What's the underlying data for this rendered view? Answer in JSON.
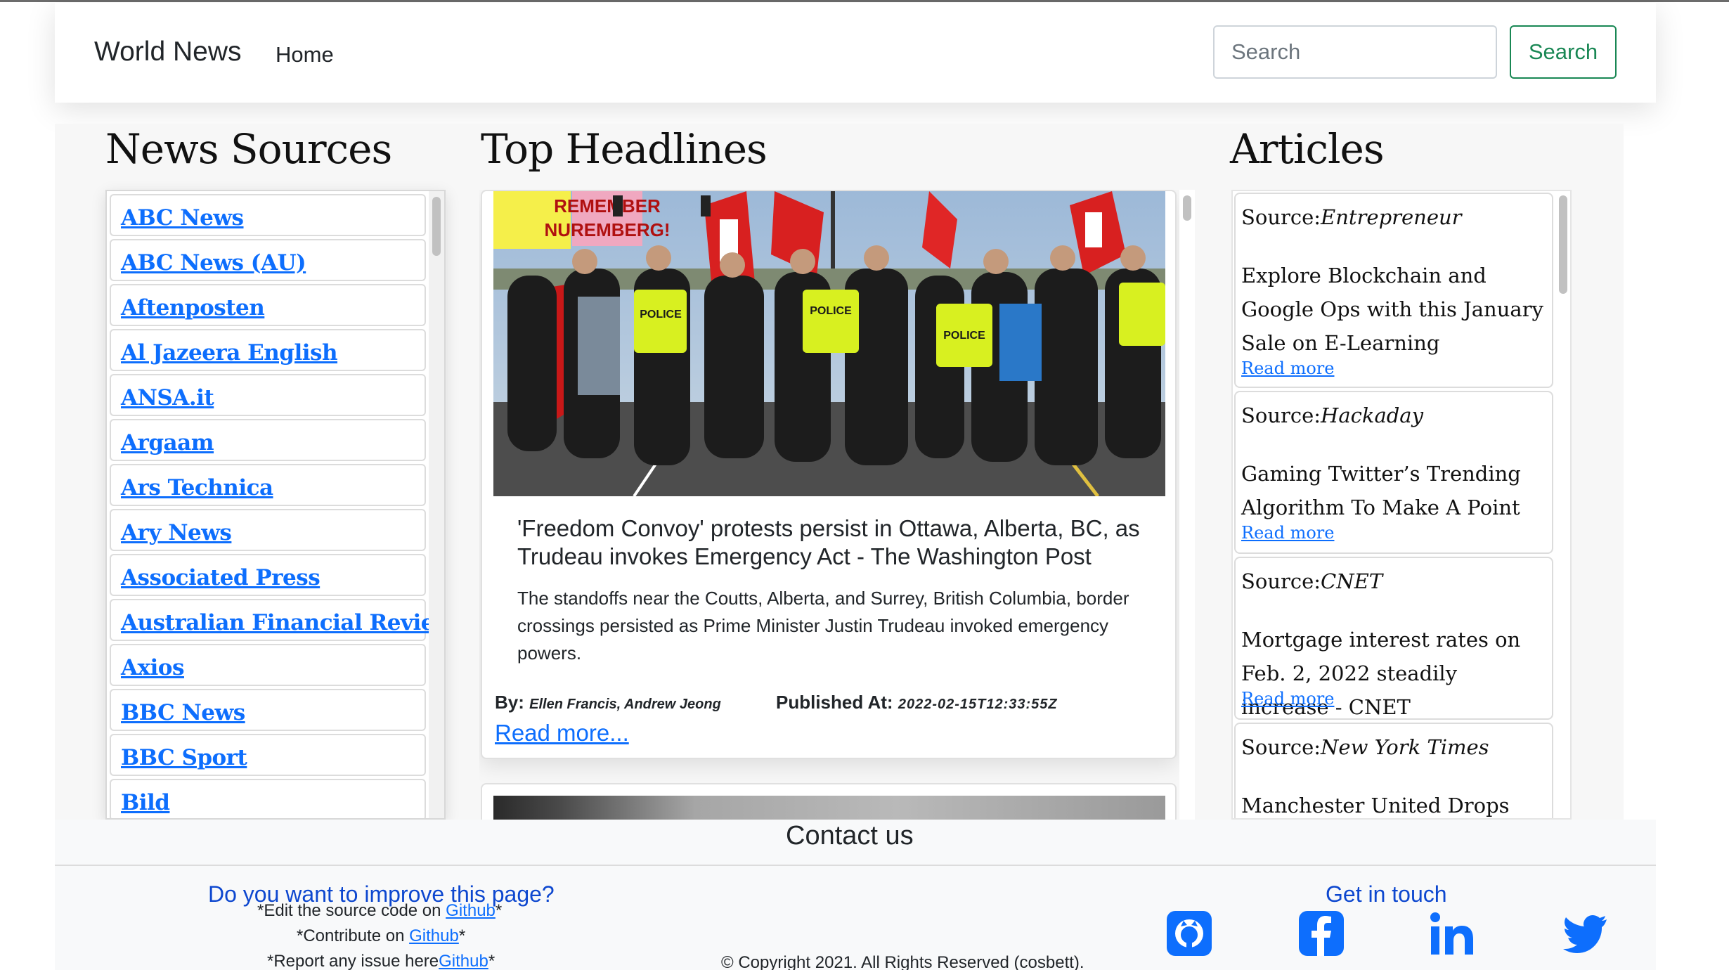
{
  "navbar": {
    "brand": "World News",
    "home": "Home",
    "search_placeholder": "Search",
    "search_button": "Search"
  },
  "columns": {
    "sources_title": "News Sources",
    "headlines_title": "Top Headlines",
    "articles_title": "Articles"
  },
  "sources": [
    "ABC News",
    "ABC News (AU)",
    "Aftenposten",
    "Al Jazeera English",
    "ANSA.it",
    "Argaam",
    "Ars Technica",
    "Ary News",
    "Associated Press",
    "Australian Financial Review",
    "Axios",
    "BBC News",
    "BBC Sport",
    "Bild"
  ],
  "headline": {
    "title": "'Freedom Convoy' protests persist in Ottawa, Alberta, BC, as Trudeau invokes Emergency Act - The Washington Post",
    "description": "The standoffs near the Coutts, Alberta, and Surrey, British Columbia, border crossings persisted as Prime Minister Justin Trudeau invoked emergency powers.",
    "by_label": "By:",
    "author": "Ellen Francis, Andrew Jeong",
    "published_label": "Published At:",
    "published_at": "2022-02-15T12:33:55Z",
    "read_more": "Read more...",
    "sign_1": "REMEMBER",
    "sign_2": "NUREMBERG!",
    "police_1": "POLICE",
    "police_2": "POLICE",
    "police_3": "POLICE"
  },
  "articles": {
    "source_label": "Source:",
    "read_more": "Read more",
    "items": [
      {
        "source": "Entrepreneur",
        "title": "Explore Blockchain and Google Ops with this January Sale on E-Learning"
      },
      {
        "source": "Hackaday",
        "title": "Gaming Twitter’s Trending Algorithm To Make A Point"
      },
      {
        "source": "CNET",
        "title": "Mortgage interest rates on Feb. 2, 2022 steadily increase - CNET"
      },
      {
        "source": "New York Times",
        "title": "Manchester United Drops Mason"
      }
    ]
  },
  "footer": {
    "contact_title": "Contact us",
    "improve_title": "Do you want to improve this page?",
    "edit_prefix": "*Edit the source code on ",
    "edit_link": "Github",
    "edit_suffix": "*",
    "contribute_prefix": "*Contribute on ",
    "contribute_link": "Github",
    "contribute_suffix": "*",
    "issue_prefix": "*Report any issue here",
    "issue_link": "Github",
    "issue_suffix": "*",
    "touch_title": "Get in touch",
    "copyright": "© Copyright 2021. All Rights Reserved (cosbett).",
    "social_icons": [
      "github-icon",
      "facebook-icon",
      "linkedin-icon",
      "twitter-icon"
    ]
  },
  "colors": {
    "link": "#0d6efd",
    "success": "#198754",
    "footer_heading": "#0d47cf"
  }
}
